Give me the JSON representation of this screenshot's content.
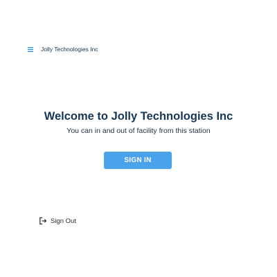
{
  "header": {
    "menu_icon": "hamburger-menu-icon",
    "app_name": "Jolly Technologies Inc"
  },
  "welcome": {
    "title": "Welcome to Jolly Technologies Inc",
    "subtitle": "You can in and out of facility from this station"
  },
  "sign_in": {
    "label": "SIGN IN"
  },
  "sign_out": {
    "icon": "sign-out-icon",
    "label": "Sign Out"
  },
  "colors": {
    "accent": "#4aa3ea",
    "title": "#173654",
    "menu_icon": "#2b8fd6"
  }
}
